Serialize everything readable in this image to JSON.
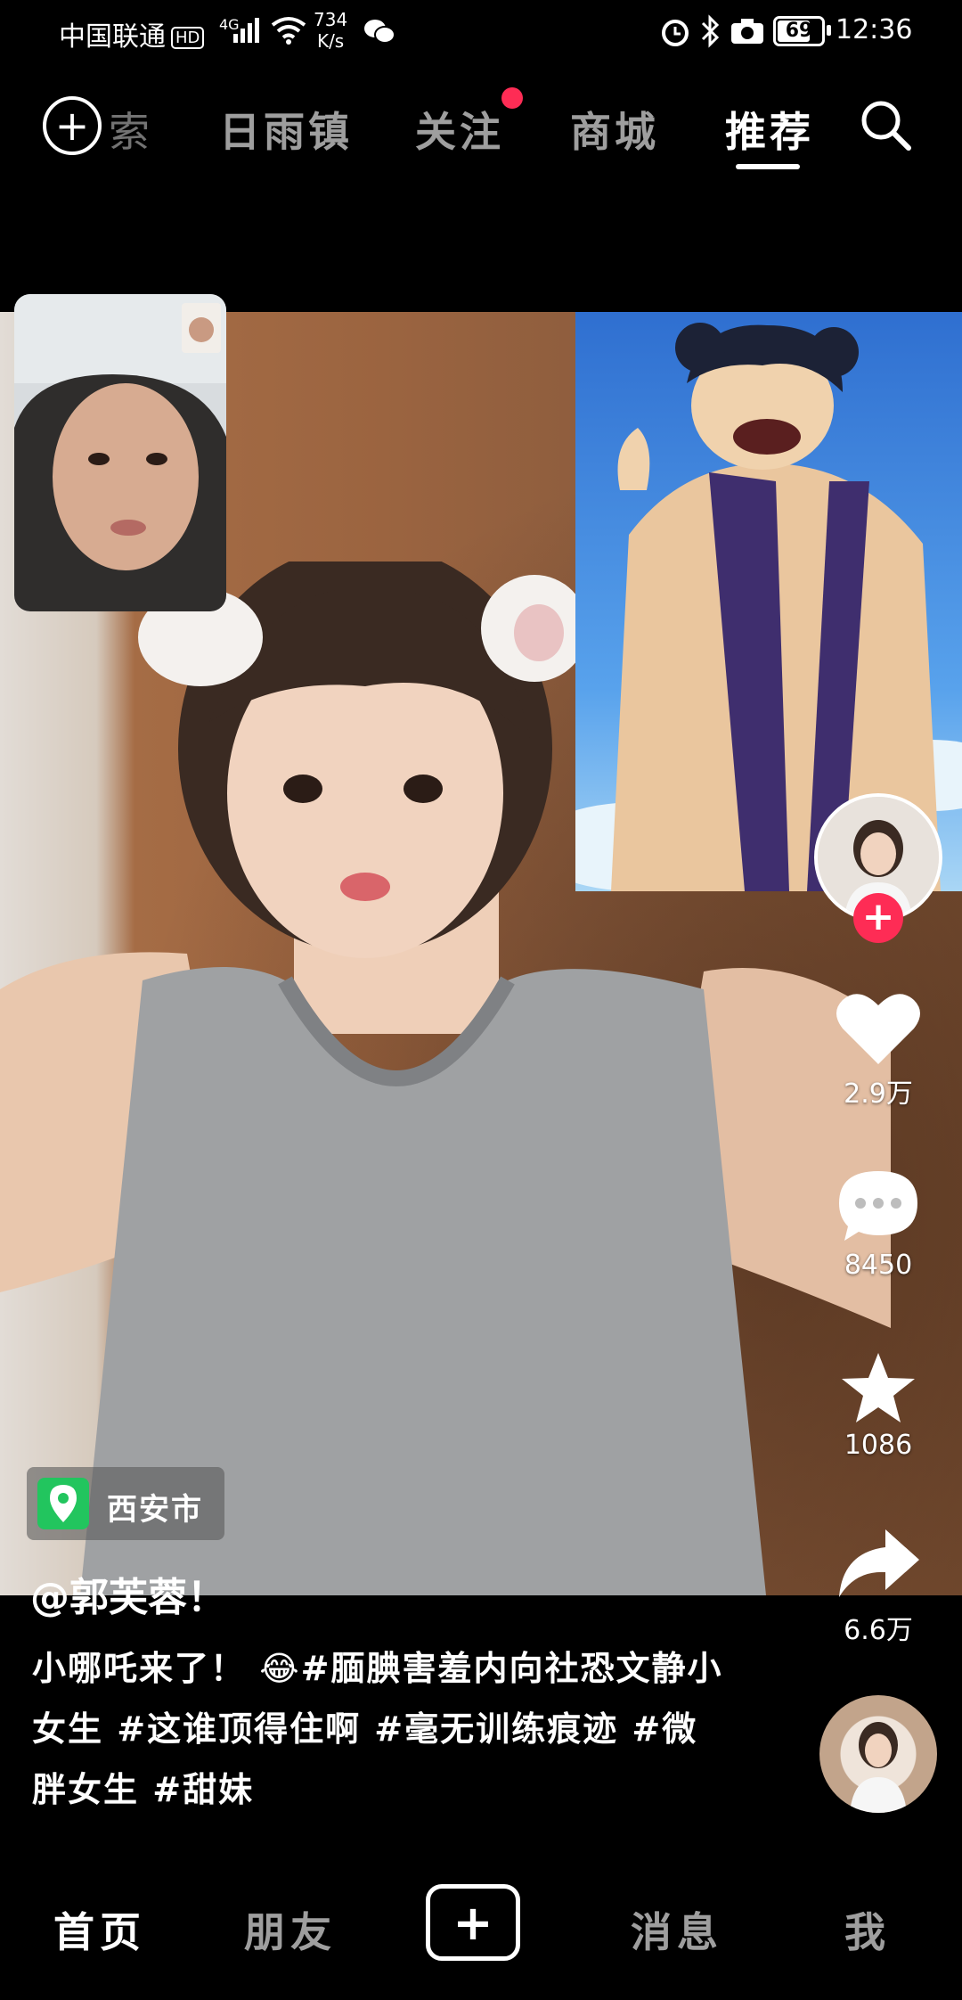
{
  "status_bar": {
    "carrier": "中国联通",
    "hd": "HD",
    "network": "4G",
    "net_speed_value": "734",
    "net_speed_unit": "K/s",
    "battery": "69",
    "time": "12:36"
  },
  "top_nav": {
    "ghost_tab": "索",
    "tabs": [
      {
        "label": "日雨镇",
        "active": false
      },
      {
        "label": "关注",
        "active": false,
        "dot": true
      },
      {
        "label": "商城",
        "active": false
      },
      {
        "label": "推荐",
        "active": true
      }
    ]
  },
  "actions": {
    "likes": "2.9万",
    "comments": "8450",
    "favorites": "1086",
    "shares": "6.6万"
  },
  "location": "西安市",
  "author": "@郭芙蓉！",
  "caption": "小哪吒来了！ 😂#腼腆害羞内向社恐文静小女生 #这谁顶得住啊 #毫无训练痕迹 #微胖女生 #甜妹",
  "bottom_nav": {
    "home": "首页",
    "friends": "朋友",
    "messages": "消息",
    "me": "我"
  },
  "colors": {
    "accent": "#fe2c55",
    "location_pin": "#22c55e",
    "background": "#000000"
  }
}
